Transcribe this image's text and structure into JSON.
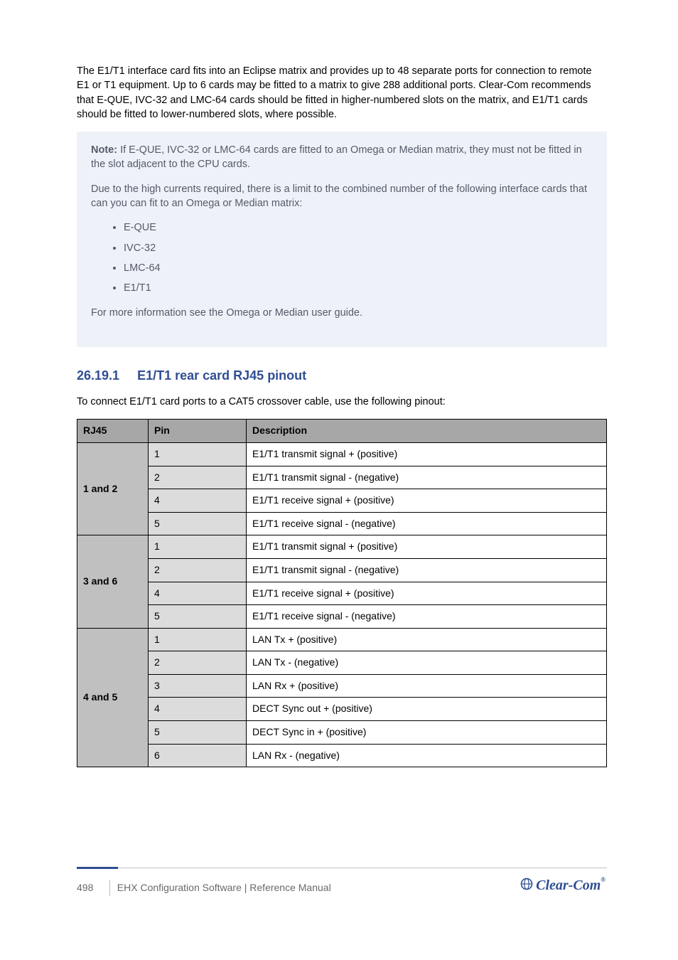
{
  "intro": "The E1/T1 interface card fits into an Eclipse matrix and provides up to 48 separate ports for connection to remote E1 or T1 equipment. Up to 6 cards may be fitted to a matrix to give 288 additional ports. Clear-Com recommends that E-QUE, IVC-32 and LMC-64 cards should be fitted in higher-numbered slots on the matrix, and E1/T1 cards should be fitted to lower-numbered slots, where possible.",
  "note": {
    "p1": "If E-QUE, IVC-32 or LMC-64 cards are fitted to an Omega or Median matrix, they must not be fitted in the slot adjacent to the CPU cards.",
    "p2": "Due to the high currents required, there is a limit to the combined number of the following interface cards that can you can fit to an Omega or Median matrix:",
    "items": [
      "E-QUE",
      "IVC-32",
      "LMC-64",
      "E1/T1"
    ],
    "p3": "For more information see the Omega or Median user guide."
  },
  "subsection": {
    "number": "26.19.1",
    "title": "E1/T1 rear card RJ45 pinout",
    "lead": "To connect E1/T1 card ports to a CAT5 crossover cable, use the following pinout:"
  },
  "table": {
    "headers": [
      "RJ45",
      "Pin",
      "Description"
    ],
    "groups": [
      {
        "label": "1 and 2",
        "rows": [
          {
            "pin": "1",
            "desc": "E1/T1 transmit signal + (positive)"
          },
          {
            "pin": "2",
            "desc": "E1/T1 transmit signal - (negative)"
          },
          {
            "pin": "4",
            "desc": "E1/T1 receive signal + (positive)"
          },
          {
            "pin": "5",
            "desc": "E1/T1 receive signal - (negative)"
          }
        ]
      },
      {
        "label": "3 and 6",
        "rows": [
          {
            "pin": "1",
            "desc": "E1/T1 transmit signal + (positive)"
          },
          {
            "pin": "2",
            "desc": "E1/T1 transmit signal - (negative)"
          },
          {
            "pin": "4",
            "desc": "E1/T1 receive signal + (positive)"
          },
          {
            "pin": "5",
            "desc": "E1/T1 receive signal - (negative)"
          }
        ]
      },
      {
        "label": "4 and 5",
        "rows": [
          {
            "pin": "1",
            "desc": "LAN Tx + (positive)"
          },
          {
            "pin": "2",
            "desc": "LAN Tx - (negative)"
          },
          {
            "pin": "3",
            "desc": "LAN Rx + (positive)"
          },
          {
            "pin": "4",
            "desc": "DECT Sync out + (positive)"
          },
          {
            "pin": "5",
            "desc": "DECT Sync in + (positive)"
          },
          {
            "pin": "6",
            "desc": "LAN Rx - (negative)"
          }
        ]
      }
    ]
  },
  "footer": {
    "page": "498",
    "doc": "EHX Configuration Software | Reference Manual"
  },
  "brand": "Clear-Com"
}
